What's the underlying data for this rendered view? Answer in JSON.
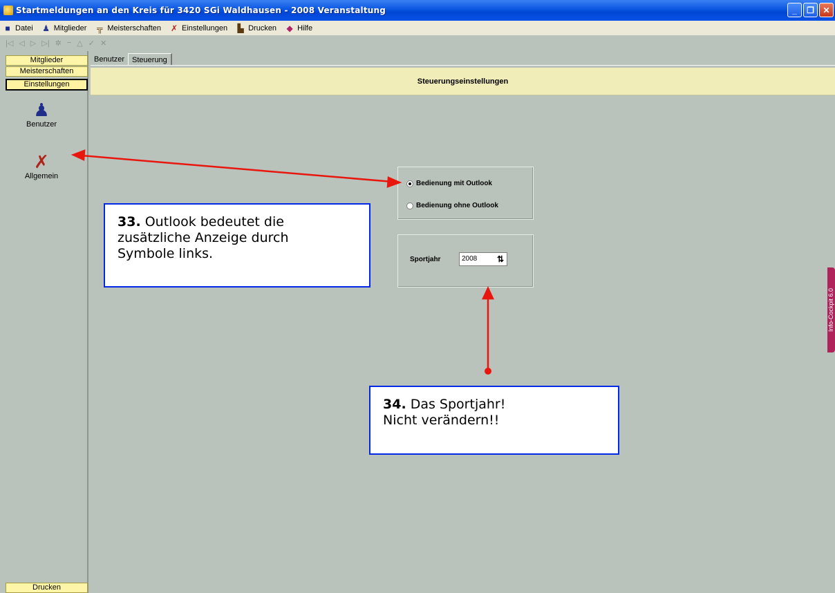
{
  "window": {
    "title": "Startmeldungen an den Kreis für 3420 SGi Waldhausen - 2008   Veranstaltung"
  },
  "menubar": {
    "items": [
      {
        "label": "Datei",
        "icon": "save-icon"
      },
      {
        "label": "Mitglieder",
        "icon": "person-icon"
      },
      {
        "label": "Meisterschaften",
        "icon": "table-icon"
      },
      {
        "label": "Einstellungen",
        "icon": "tools-icon"
      },
      {
        "label": "Drucken",
        "icon": "printer-icon"
      },
      {
        "label": "Hilfe",
        "icon": "help-icon"
      }
    ]
  },
  "leftnav": {
    "mitglieder": "Mitglieder",
    "meisterschaften": "Meisterschaften",
    "einstellungen": "Einstellungen",
    "benutzer": "Benutzer",
    "allgemein": "Allgemein",
    "drucken": "Drucken"
  },
  "tabs": [
    "Benutzer",
    "Steuerung"
  ],
  "header": {
    "title": "Steuerungseinstellungen"
  },
  "settings": {
    "radio_with": "Bedienung mit Outlook",
    "radio_without": "Bedienung ohne Outlook",
    "selected": "Bedienung mit Outlook",
    "sportjahr_label": "Sportjahr",
    "sportjahr_value": "2008"
  },
  "callouts": {
    "c33_num": "33.",
    "c33_text1": "Outlook bedeutet die",
    "c33_text2": "zusätzliche Anzeige durch",
    "c33_text3": "Symbole links.",
    "c34_num": "34.",
    "c34_text1": "Das Sportjahr!",
    "c34_text2": "Nicht verändern!!"
  },
  "side_tab": {
    "label": "Info-Cockpit 6.0"
  },
  "colors": {
    "arrow": "#e8160c",
    "callout_border": "#0028e6",
    "titlebar": "#0a56e0"
  }
}
